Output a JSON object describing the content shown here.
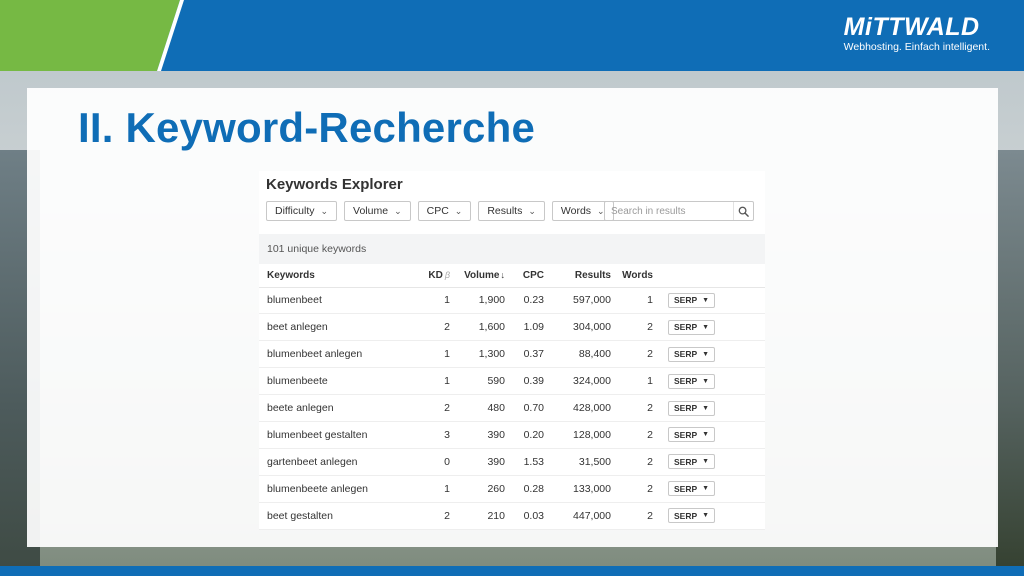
{
  "brand": {
    "name": "MiTTWALD",
    "tagline": "Webhosting. Einfach intelligent."
  },
  "slide": {
    "title": "II. Keyword-Recherche"
  },
  "colors": {
    "primary_blue": "#0f6db6",
    "accent_green": "#76b944"
  },
  "keywords_explorer": {
    "title": "Keywords Explorer",
    "filters": [
      "Difficulty",
      "Volume",
      "CPC",
      "Results",
      "Words"
    ],
    "search_placeholder": "Search in results",
    "summary": "101 unique keywords",
    "columns": {
      "keyword": "Keywords",
      "kd": "KD",
      "kd_beta": "β",
      "volume": "Volume",
      "volume_sort": "↓",
      "cpc": "CPC",
      "results": "Results",
      "words": "Words"
    },
    "serp_label": "SERP",
    "rows": [
      {
        "keyword": "blumenbeet",
        "kd": "1",
        "volume": "1,900",
        "cpc": "0.23",
        "results": "597,000",
        "words": "1"
      },
      {
        "keyword": "beet anlegen",
        "kd": "2",
        "volume": "1,600",
        "cpc": "1.09",
        "results": "304,000",
        "words": "2"
      },
      {
        "keyword": "blumenbeet anlegen",
        "kd": "1",
        "volume": "1,300",
        "cpc": "0.37",
        "results": "88,400",
        "words": "2"
      },
      {
        "keyword": "blumenbeete",
        "kd": "1",
        "volume": "590",
        "cpc": "0.39",
        "results": "324,000",
        "words": "1"
      },
      {
        "keyword": "beete anlegen",
        "kd": "2",
        "volume": "480",
        "cpc": "0.70",
        "results": "428,000",
        "words": "2"
      },
      {
        "keyword": "blumenbeet gestalten",
        "kd": "3",
        "volume": "390",
        "cpc": "0.20",
        "results": "128,000",
        "words": "2"
      },
      {
        "keyword": "gartenbeet anlegen",
        "kd": "0",
        "volume": "390",
        "cpc": "1.53",
        "results": "31,500",
        "words": "2"
      },
      {
        "keyword": "blumenbeete anlegen",
        "kd": "1",
        "volume": "260",
        "cpc": "0.28",
        "results": "133,000",
        "words": "2"
      },
      {
        "keyword": "beet gestalten",
        "kd": "2",
        "volume": "210",
        "cpc": "0.03",
        "results": "447,000",
        "words": "2"
      }
    ]
  }
}
